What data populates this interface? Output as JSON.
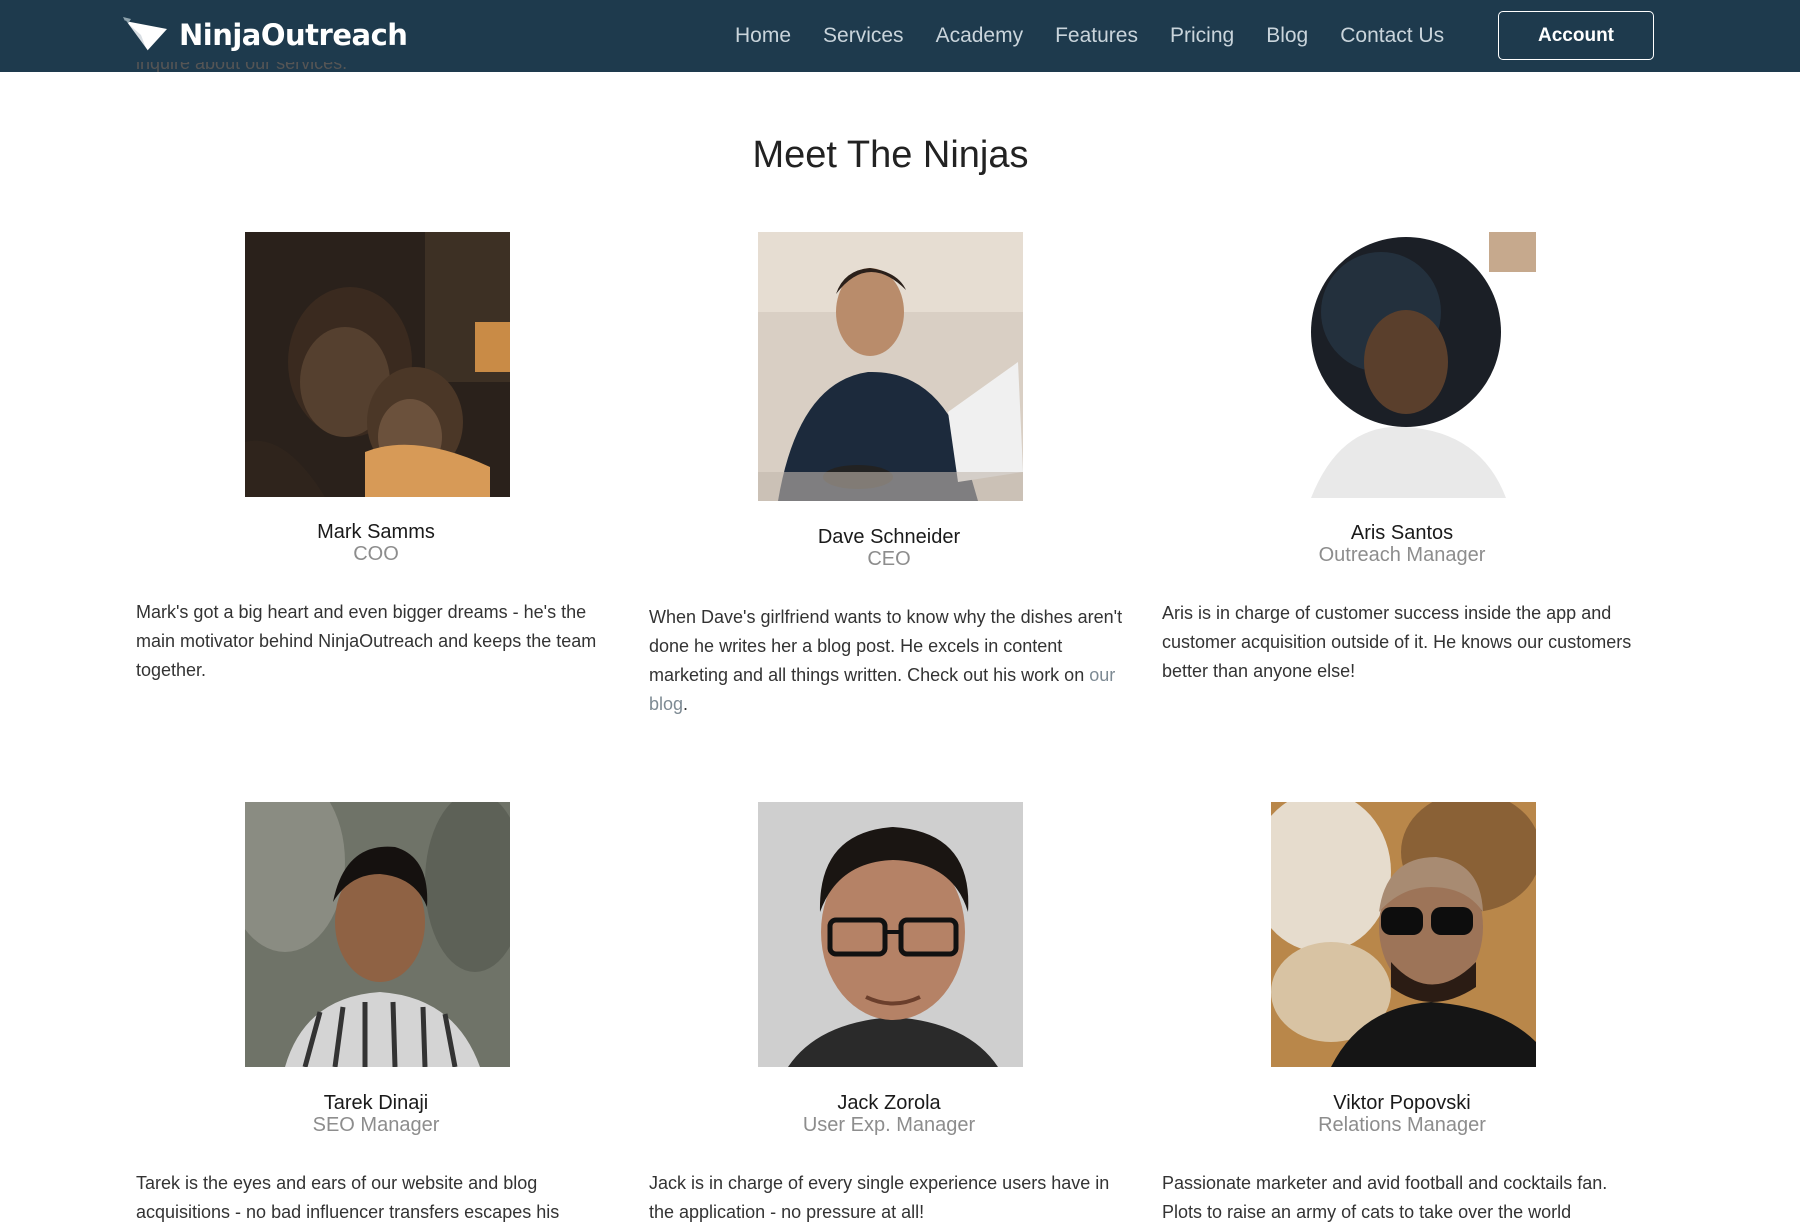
{
  "nav": {
    "logo_text": "NinjaOutreach",
    "links": [
      "Home",
      "Services",
      "Academy",
      "Features",
      "Pricing",
      "Blog",
      "Contact Us"
    ],
    "account_label": "Account"
  },
  "intro_peek": "inquire about our services.",
  "section_title": "Meet The Ninjas",
  "team": [
    {
      "name": "Mark Samms",
      "role": "COO",
      "bio": "Mark's got a big heart and even bigger dreams - he's the main motivator behind NinjaOutreach and keeps the team together."
    },
    {
      "name": "Dave Schneider",
      "role": "CEO",
      "bio": "When Dave's girlfriend wants to know why the dishes aren't done he writes her a blog post. He excels in content marketing and all things written. Check out his work on",
      "bio_link": "our blog",
      "bio_end": "."
    },
    {
      "name": "Aris Santos",
      "role": "Outreach Manager",
      "bio": "Aris is in charge of customer success inside the app and customer acquisition outside of it. He knows our customers better than anyone else!"
    },
    {
      "name": "Tarek Dinaji",
      "role": "SEO Manager",
      "bio": "Tarek is the eyes and ears of our website and blog acquisitions - no bad influencer transfers escapes his"
    },
    {
      "name": "Jack Zorola",
      "role": "User Exp. Manager",
      "bio": "Jack is in charge of every single experience users have in the application - no pressure at all!"
    },
    {
      "name": "Viktor Popovski",
      "role": "Relations Manager",
      "bio": "Passionate marketer and avid football and cocktails fan. Plots to raise an army of cats to take over the world"
    }
  ],
  "colors": {
    "navbar_bg": "#1e3a4d",
    "nav_link": "#c9d4db",
    "role_text": "#8d8d8d",
    "link_text": "#7d8a93"
  }
}
